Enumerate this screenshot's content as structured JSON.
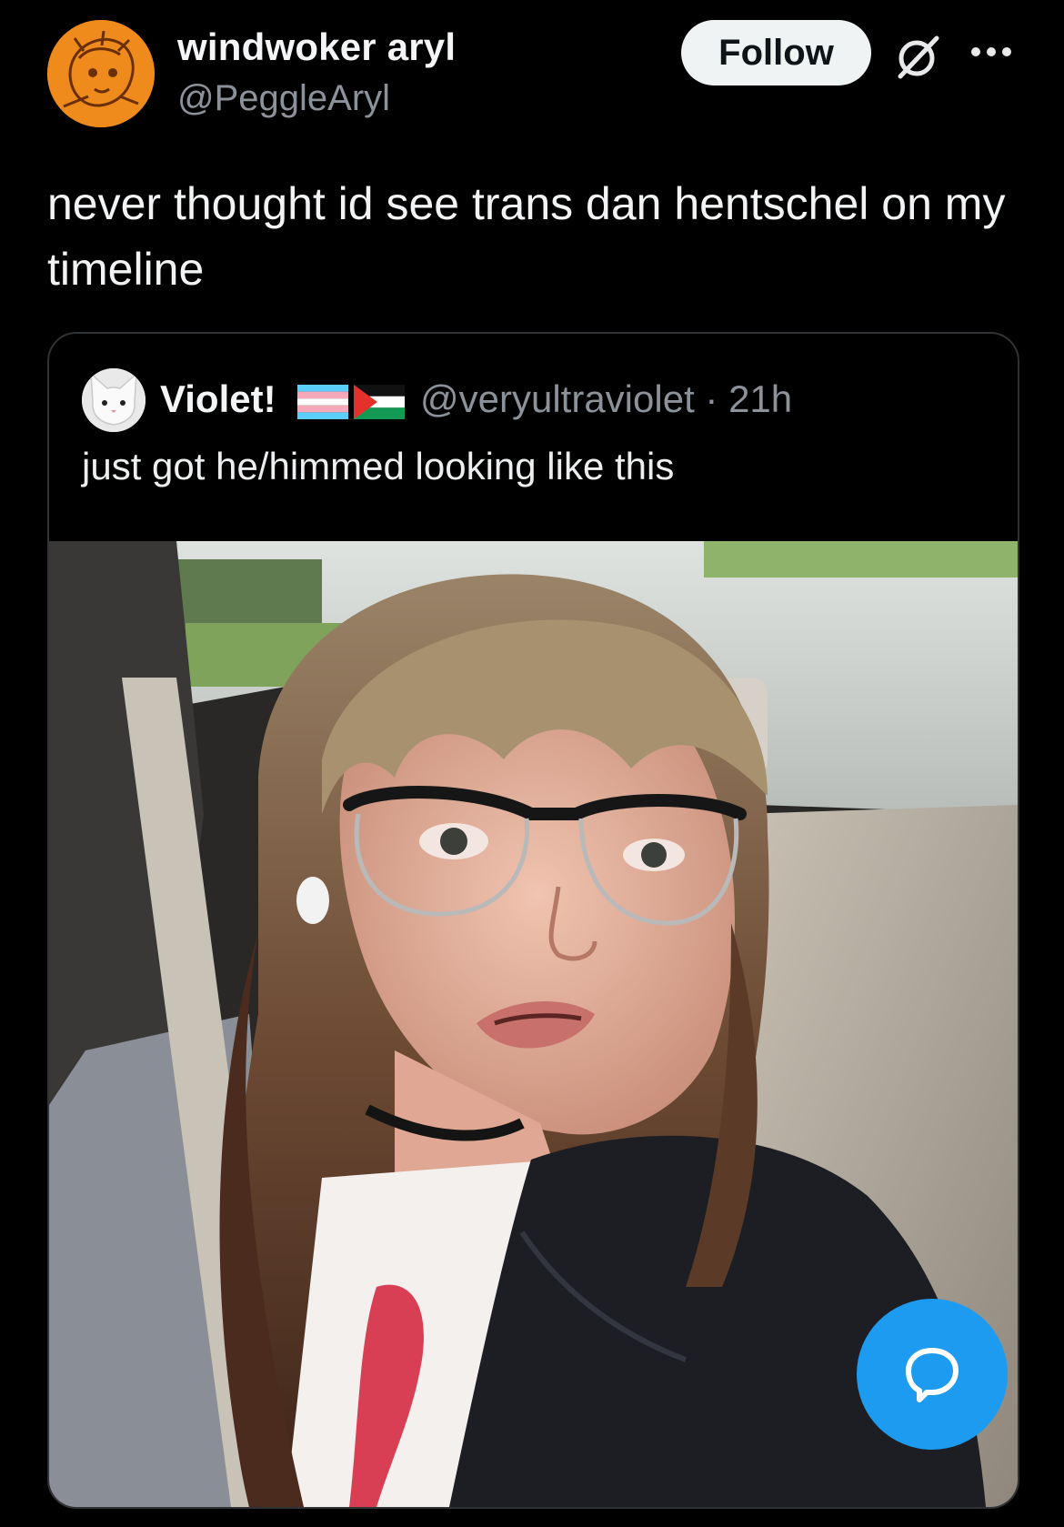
{
  "tweet": {
    "author_name": "windwoker aryl",
    "author_handle": "@PeggleAryl",
    "follow_label": "Follow",
    "text": "never thought id see trans dan hentschel on my timeline"
  },
  "quoted": {
    "author_name": "Violet!",
    "author_handle": "@veryultraviolet",
    "separator": "·",
    "timestamp": "21h",
    "text": "just got he/himmed looking like this"
  },
  "icons": {
    "grok": "grok-icon",
    "more": "more-icon",
    "compose": "chat-bubble-icon"
  },
  "colors": {
    "background": "#000000",
    "follow_bg": "#eff3f4",
    "fab_bg": "#1d9bf0",
    "secondary_text": "#8b9299",
    "avatar_orange": "#ef8a1c"
  }
}
